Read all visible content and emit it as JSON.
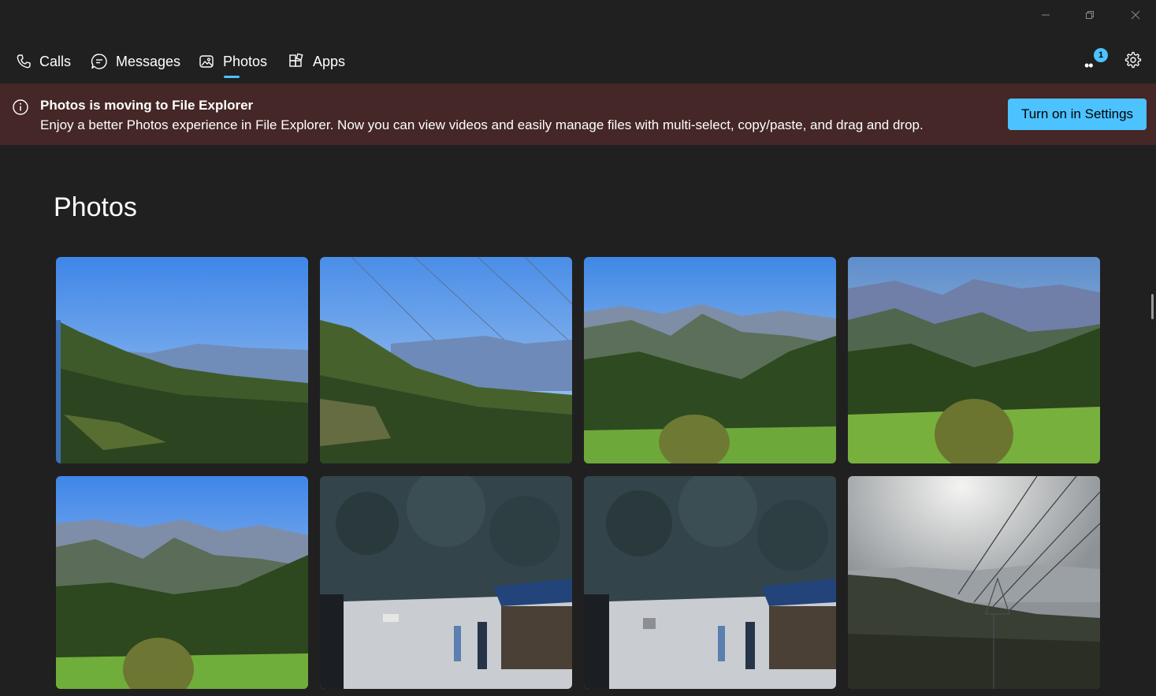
{
  "window": {
    "minimize_icon": "minimize-icon",
    "restore_icon": "restore-icon",
    "close_icon": "close-icon"
  },
  "nav": {
    "items": [
      {
        "label": "Calls",
        "icon": "phone-icon"
      },
      {
        "label": "Messages",
        "icon": "chat-icon"
      },
      {
        "label": "Photos",
        "icon": "photo-icon",
        "selected": true
      },
      {
        "label": "Apps",
        "icon": "apps-icon"
      }
    ],
    "more_badge": "1",
    "accent_color": "#4cc2ff"
  },
  "banner": {
    "title": "Photos is moving to File Explorer",
    "text": "Enjoy a better Photos experience in File Explorer. Now you can view videos and easily manage files with multi-select, copy/paste, and drag and drop.",
    "button_label": "Turn on in Settings",
    "background": "#442726"
  },
  "page": {
    "title": "Photos"
  },
  "photos": [
    {
      "scene": "mountain valley with blue sky"
    },
    {
      "scene": "mountain slope with power lines"
    },
    {
      "scene": "mountain range with green fields"
    },
    {
      "scene": "mountain range with shrub and terraces"
    },
    {
      "scene": "mountain range with shrub and terraces"
    },
    {
      "scene": "forest road with market stall"
    },
    {
      "scene": "forest road with market stall"
    },
    {
      "scene": "hazy sun over pylons"
    }
  ]
}
